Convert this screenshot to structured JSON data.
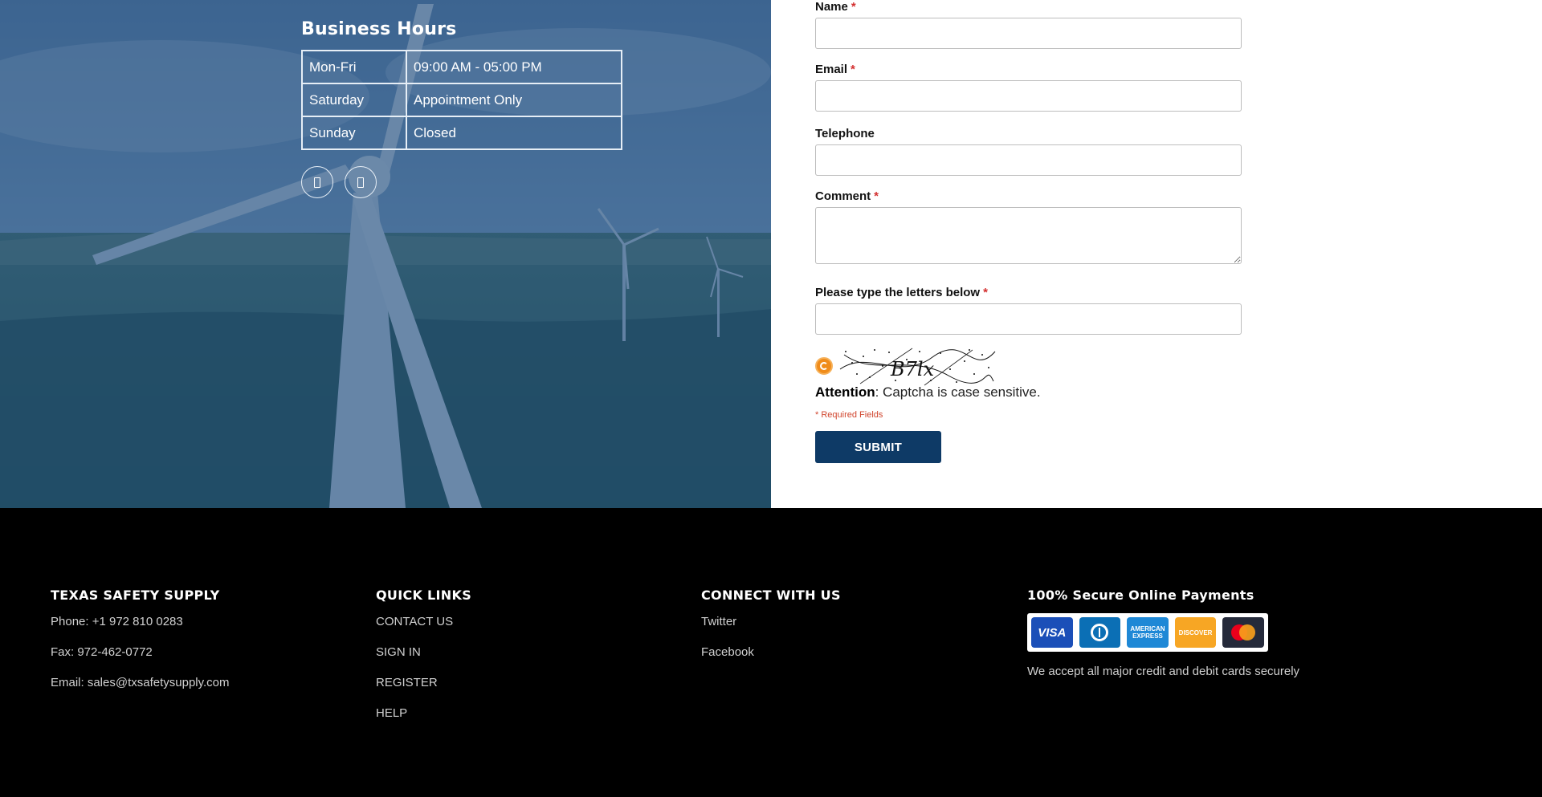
{
  "business_hours": {
    "title": "Business Hours",
    "rows": [
      {
        "day": "Mon-Fri",
        "hours": "09:00 AM - 05:00 PM"
      },
      {
        "day": "Saturday",
        "hours": "Appointment Only"
      },
      {
        "day": "Sunday",
        "hours": "Closed"
      }
    ],
    "social_icons": [
      "twitter-icon",
      "facebook-icon"
    ]
  },
  "form": {
    "name_label": "Name",
    "email_label": "Email",
    "telephone_label": "Telephone",
    "comment_label": "Comment",
    "captcha_label": "Please type the letters below",
    "required_marker": "*",
    "captcha_text": "B7lx",
    "attention_strong": "Attention",
    "attention_text": ": Captcha is case sensitive.",
    "required_note": "* Required Fields",
    "submit_label": "SUBMIT"
  },
  "footer": {
    "company": {
      "heading": "TEXAS SAFETY SUPPLY",
      "phone": "Phone: +1 972 810 0283",
      "fax": "Fax: 972-462-0772",
      "email": "Email: sales@txsafetysupply.com"
    },
    "quick_links": {
      "heading": "QUICK LINKS",
      "items": [
        "CONTACT US",
        "SIGN IN",
        "REGISTER",
        "HELP"
      ]
    },
    "connect": {
      "heading": "CONNECT WITH US",
      "items": [
        " Twitter",
        " Facebook"
      ]
    },
    "payments": {
      "heading": "100% Secure Online Payments",
      "cards": [
        "VISA",
        "Diners Club",
        "AMERICAN EXPRESS",
        "DISCOVER",
        "Mastercard"
      ],
      "note": "We accept all major credit and debit cards securely"
    }
  },
  "colors": {
    "overlay": "#1f4a7a",
    "submit_bg": "#0e3a66",
    "required": "#d32f2f"
  }
}
